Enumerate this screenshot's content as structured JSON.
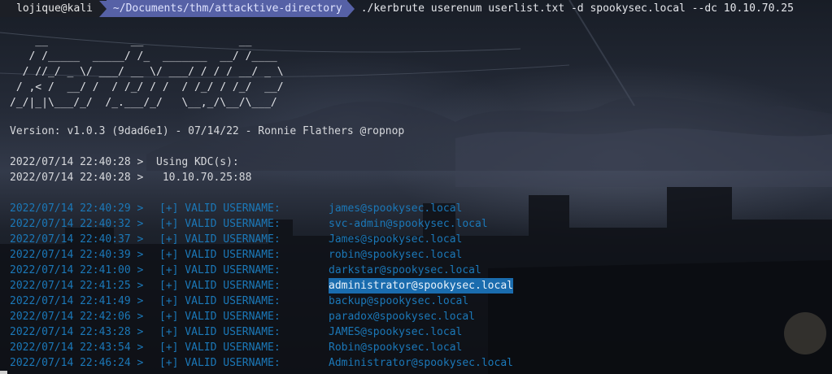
{
  "prompt": {
    "user_host": "lojique@kali",
    "directory": "~/Documents/thm/attacktive-directory",
    "command": "./kerbrute userenum userlist.txt -d spookysec.local --dc 10.10.70.25"
  },
  "banner_art": "    __             __               __     \n   / /_____  _____/ /_  _______  __/ /____ \n  / //_/ _ \\/ ___/ __ \\/ ___/ / / / __/ _ \\\n / ,< /  __/ /  / /_/ / /  / /_/ / /_/  __/\n/_/|_|\\___/_/  /_.___/_/   \\__,_/\\__/\\___/ ",
  "version_line": "Version: v1.0.3 (9dad6e1) - 07/14/22 - Ronnie Flathers @ropnop",
  "kdc_lines": [
    "2022/07/14 22:40:28 >  Using KDC(s):",
    "2022/07/14 22:40:28 >   10.10.70.25:88"
  ],
  "valid_tag": "[+] VALID USERNAME:",
  "results": [
    {
      "timestamp": "2022/07/14 22:40:29 >",
      "username": "james@spookysec.local"
    },
    {
      "timestamp": "2022/07/14 22:40:32 >",
      "username": "svc-admin@spookysec.local"
    },
    {
      "timestamp": "2022/07/14 22:40:37 >",
      "username": "James@spookysec.local"
    },
    {
      "timestamp": "2022/07/14 22:40:39 >",
      "username": "robin@spookysec.local"
    },
    {
      "timestamp": "2022/07/14 22:41:00 >",
      "username": "darkstar@spookysec.local"
    },
    {
      "timestamp": "2022/07/14 22:41:25 >",
      "username": "administrator@spookysec.local",
      "selected": true
    },
    {
      "timestamp": "2022/07/14 22:41:49 >",
      "username": "backup@spookysec.local"
    },
    {
      "timestamp": "2022/07/14 22:42:06 >",
      "username": "paradox@spookysec.local"
    },
    {
      "timestamp": "2022/07/14 22:43:28 >",
      "username": "JAMES@spookysec.local"
    },
    {
      "timestamp": "2022/07/14 22:43:54 >",
      "username": "Robin@spookysec.local"
    },
    {
      "timestamp": "2022/07/14 22:46:24 >",
      "username": "Administrator@spookysec.local"
    }
  ],
  "colors": {
    "result_text": "#1b78b8",
    "selection_bg": "#1a6cae",
    "prompt_dir_bg": "#5661a6"
  }
}
